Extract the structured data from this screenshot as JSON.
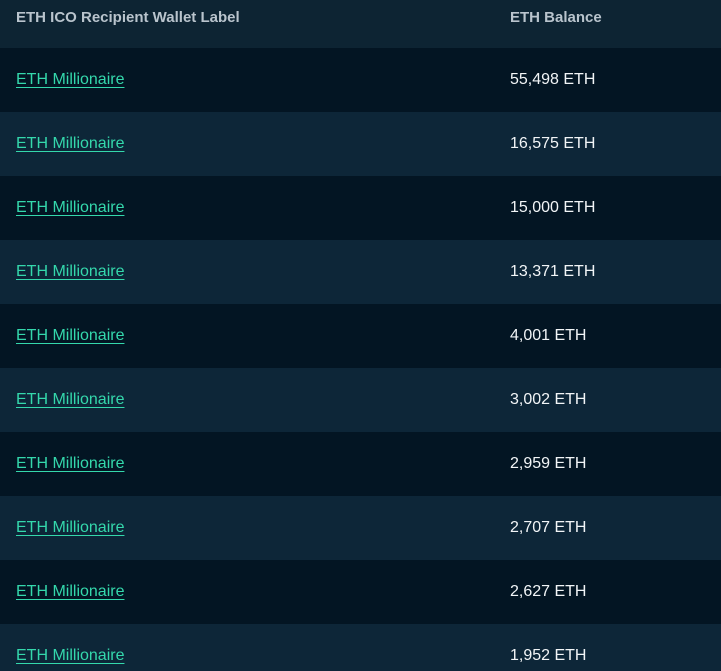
{
  "table": {
    "columns": [
      "ETH ICO Recipient Wallet Label",
      "ETH Balance"
    ],
    "rows": [
      {
        "label": "ETH Millionaire",
        "balance": "55,498 ETH"
      },
      {
        "label": "ETH Millionaire",
        "balance": "16,575 ETH"
      },
      {
        "label": "ETH Millionaire",
        "balance": "15,000 ETH"
      },
      {
        "label": "ETH Millionaire",
        "balance": "13,371 ETH"
      },
      {
        "label": "ETH Millionaire",
        "balance": "4,001 ETH"
      },
      {
        "label": "ETH Millionaire",
        "balance": "3,002 ETH"
      },
      {
        "label": "ETH Millionaire",
        "balance": "2,959 ETH"
      },
      {
        "label": "ETH Millionaire",
        "balance": "2,707 ETH"
      },
      {
        "label": "ETH Millionaire",
        "balance": "2,627 ETH"
      },
      {
        "label": "ETH Millionaire",
        "balance": "1,952 ETH"
      }
    ]
  },
  "colors": {
    "link": "#34d8ac",
    "row_dark": "#031523",
    "row_light": "#0d2638",
    "header_bg": "#0d2433"
  }
}
